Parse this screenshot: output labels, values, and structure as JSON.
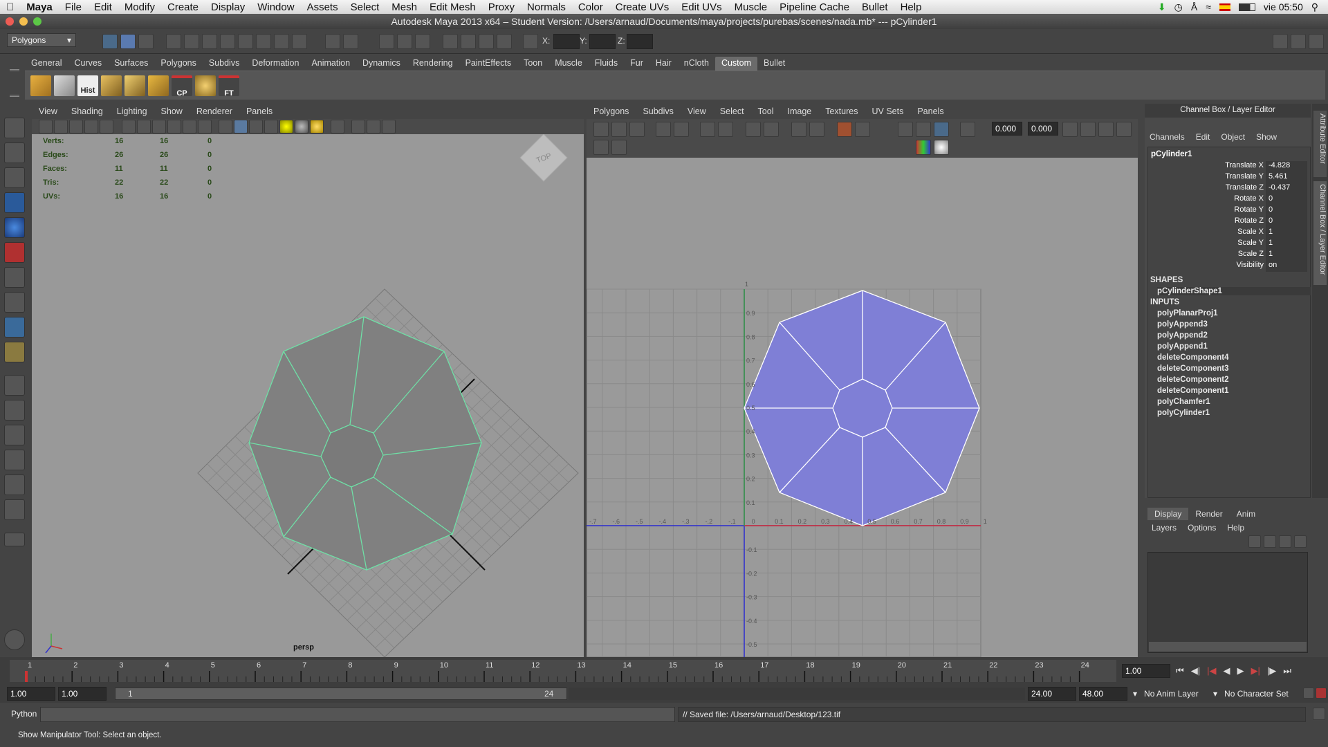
{
  "mac_menubar": {
    "app": "Maya",
    "items": [
      "File",
      "Edit",
      "Modify",
      "Create",
      "Display",
      "Window",
      "Assets",
      "Select",
      "Mesh",
      "Edit Mesh",
      "Proxy",
      "Normals",
      "Color",
      "Create UVs",
      "Edit UVs",
      "Muscle",
      "Pipeline Cache",
      "Bullet",
      "Help"
    ],
    "clock": "vie 05:50"
  },
  "window": {
    "title": "Autodesk Maya 2013 x64 – Student Version: /Users/arnaud/Documents/maya/projects/purebas/scenes/nada.mb*   ---   pCylinder1"
  },
  "status_line": {
    "menu_set": "Polygons",
    "x_label": "X:",
    "y_label": "Y:",
    "z_label": "Z:"
  },
  "shelf": {
    "tabs": [
      "General",
      "Curves",
      "Surfaces",
      "Polygons",
      "Subdivs",
      "Deformation",
      "Animation",
      "Dynamics",
      "Rendering",
      "PaintEffects",
      "Toon",
      "Muscle",
      "Fluids",
      "Fur",
      "Hair",
      "nCloth",
      "Custom",
      "Bullet"
    ],
    "active_tab": "Custom",
    "icon_labels": {
      "hist": "Hist",
      "cp": "CP",
      "ft": "FT"
    }
  },
  "persp_panel": {
    "menu": [
      "View",
      "Shading",
      "Lighting",
      "Show",
      "Renderer",
      "Panels"
    ],
    "hud_rows": [
      {
        "label": "Verts:",
        "a": "16",
        "b": "16",
        "c": "0"
      },
      {
        "label": "Edges:",
        "a": "26",
        "b": "26",
        "c": "0"
      },
      {
        "label": "Faces:",
        "a": "11",
        "b": "11",
        "c": "0"
      },
      {
        "label": "Tris:",
        "a": "22",
        "b": "22",
        "c": "0"
      },
      {
        "label": "UVs:",
        "a": "16",
        "b": "16",
        "c": "0"
      }
    ],
    "view_cube": "TOP",
    "camera": "persp"
  },
  "uv_editor": {
    "menu": [
      "Polygons",
      "Subdivs",
      "View",
      "Select",
      "Tool",
      "Image",
      "Textures",
      "UV Sets",
      "Panels"
    ],
    "u_value": "0.000",
    "v_value": "0.000",
    "x_ticks": [
      "-.7",
      "-.6",
      "-.5",
      "-.4",
      "-.3",
      "-.2",
      "-.1",
      "0",
      "0.1",
      "0.2",
      "0.3",
      "0.4",
      "0.5",
      "0.6",
      "0.7",
      "0.8",
      "0.9",
      "1"
    ],
    "y_ticks_up": [
      "0.9",
      "0.8",
      "0.7",
      "0.6",
      "0.5",
      "0.4",
      "0.3",
      "0.2",
      "0.1"
    ],
    "y_ticks_down": [
      "-0.1",
      "-0.2",
      "-0.3",
      "-0.4",
      "-0.5"
    ],
    "top_tick": "1"
  },
  "channel_box": {
    "header": "Channel Box / Layer Editor",
    "menu": [
      "Channels",
      "Edit",
      "Object",
      "Show"
    ],
    "object": "pCylinder1",
    "attributes": [
      {
        "name": "Translate X",
        "value": "-4.828"
      },
      {
        "name": "Translate Y",
        "value": "5.461"
      },
      {
        "name": "Translate Z",
        "value": "-0.437"
      },
      {
        "name": "Rotate X",
        "value": "0"
      },
      {
        "name": "Rotate Y",
        "value": "0"
      },
      {
        "name": "Rotate Z",
        "value": "0"
      },
      {
        "name": "Scale X",
        "value": "1"
      },
      {
        "name": "Scale Y",
        "value": "1"
      },
      {
        "name": "Scale Z",
        "value": "1"
      },
      {
        "name": "Visibility",
        "value": "on"
      }
    ],
    "shapes_header": "SHAPES",
    "shape": "pCylinderShape1",
    "inputs_header": "INPUTS",
    "inputs": [
      "polyPlanarProj1",
      "polyAppend3",
      "polyAppend2",
      "polyAppend1",
      "deleteComponent4",
      "deleteComponent3",
      "deleteComponent2",
      "deleteComponent1",
      "polyChamfer1",
      "polyCylinder1"
    ],
    "side_tabs": [
      "Attribute Editor",
      "Channel Box / Layer Editor"
    ]
  },
  "layer_editor": {
    "tabs": [
      "Display",
      "Render",
      "Anim"
    ],
    "active_tab": "Display",
    "menu": [
      "Layers",
      "Options",
      "Help"
    ]
  },
  "timeline": {
    "frames": [
      "1",
      "2",
      "3",
      "4",
      "5",
      "6",
      "7",
      "8",
      "9",
      "10",
      "11",
      "12",
      "13",
      "14",
      "15",
      "16",
      "17",
      "18",
      "19",
      "20",
      "21",
      "22",
      "23",
      "24"
    ],
    "current_frame": "1.00"
  },
  "range": {
    "start": "1.00",
    "playback_start": "1.00",
    "slider_start": "1",
    "slider_end": "24",
    "playback_end": "24.00",
    "end": "48.00",
    "anim_layer": "No Anim Layer",
    "character_set": "No Character Set"
  },
  "command_line": {
    "label": "Python",
    "result": "// Saved file: /Users/arnaud/Desktop/123.tif"
  },
  "help_line": {
    "text": "Show Manipulator Tool: Select an object."
  },
  "colors": {
    "uv_fill": "#7f7fd6",
    "wire_highlight": "#66e0a0",
    "u_axis": "#d83030",
    "v_axis": "#2a2ad0"
  }
}
